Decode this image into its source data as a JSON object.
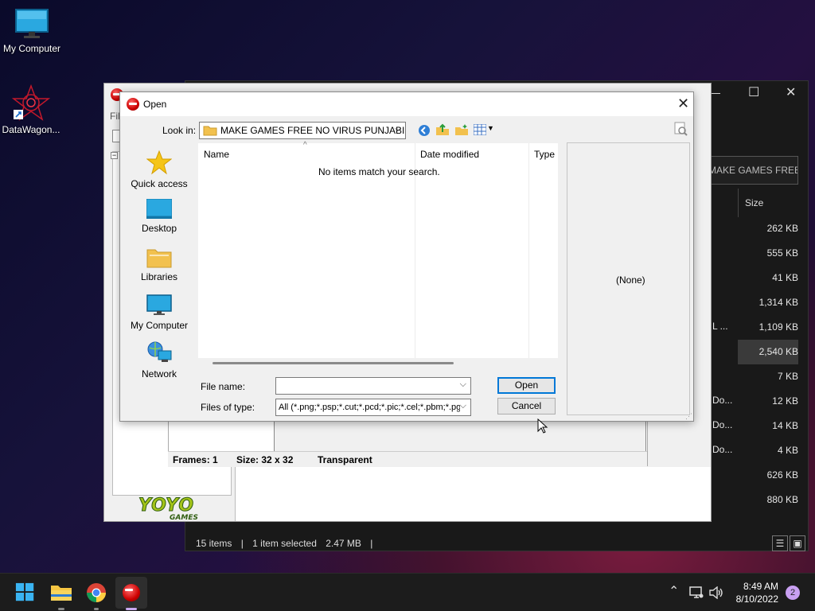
{
  "desktop": {
    "icons": [
      {
        "label": "My Computer"
      },
      {
        "label": "DataWagon..."
      }
    ]
  },
  "explorer": {
    "address_text": "MAKE GAMES FREE ...",
    "column_size": "Size",
    "sizes": [
      "262 KB",
      "555 KB",
      "41 KB",
      "1,314 KB",
      "1,109 KB",
      "2,540 KB",
      "7 KB",
      "12 KB",
      "14 KB",
      "4 KB",
      "626 KB",
      "880 KB"
    ],
    "fragments": [
      "L ...",
      "Do...",
      "Do...",
      "Do..."
    ],
    "status": {
      "items": "15 items",
      "selected": "1 item selected",
      "size": "2.47 MB"
    },
    "controls": {
      "minimize": "—",
      "maximize": "☐",
      "close": "✕"
    }
  },
  "gamemaker": {
    "menu_fragment": "Fil",
    "statusbar": {
      "frames": "Frames: 1",
      "size": "Size: 32 x 32",
      "transparent": "Transparent"
    },
    "logo": {
      "line1": "YOYO",
      "line2": "GAMES"
    }
  },
  "dialog": {
    "title": "Open",
    "look_in_label": "Look in:",
    "look_in_value": "MAKE GAMES FREE NO VIRUS PUNJABI",
    "places": [
      {
        "label": "Quick access"
      },
      {
        "label": "Desktop"
      },
      {
        "label": "Libraries"
      },
      {
        "label": "My Computer"
      },
      {
        "label": "Network"
      }
    ],
    "columns": {
      "name": "Name",
      "date": "Date modified",
      "type": "Type"
    },
    "empty_message": "No items match your search.",
    "preview_text": "(None)",
    "file_name_label": "File name:",
    "file_name_value": "",
    "files_of_type_label": "Files of type:",
    "files_of_type_value": "All (*.png;*.psp;*.cut;*.pcd;*.pic;*.cel;*.pbm;*.pg",
    "open_button": "Open",
    "cancel_button": "Cancel"
  },
  "taskbar": {
    "time": "8:49 AM",
    "date": "8/10/2022",
    "notification_count": "2"
  },
  "colors": {
    "accent": "#0078d7",
    "taskbar": "#1c1c1c",
    "dialog_bg": "#f0f0f0"
  }
}
